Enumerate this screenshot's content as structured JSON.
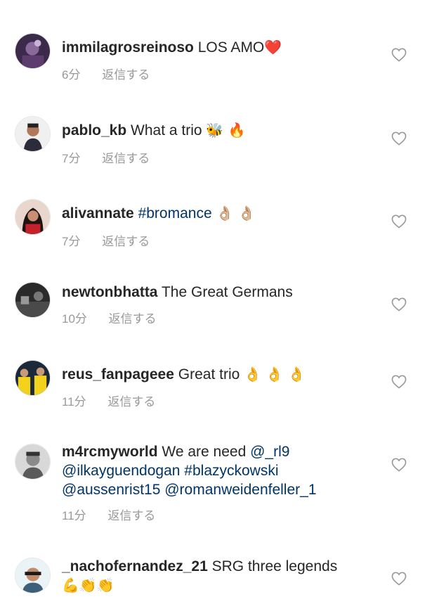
{
  "colors": {
    "username": "#262626",
    "text": "#262626",
    "link": "#003569",
    "meta": "#999999",
    "heart_outline": "#999999"
  },
  "comments": [
    {
      "username": "immilagrosreinoso",
      "text": "LOS AMO",
      "emoji": "❤️",
      "time": "6分",
      "reply": "返信する"
    },
    {
      "username": "pablo_kb",
      "text": "What a trio",
      "emoji": "🐝 🔥",
      "time": "7分",
      "reply": "返信する"
    },
    {
      "username": "alivannate",
      "hashtag": "#bromance",
      "emoji": "👌🏼 👌🏼",
      "time": "7分",
      "reply": "返信する"
    },
    {
      "username": "newtonbhatta",
      "text": "The Great Germans",
      "time": "10分",
      "reply": "返信する"
    },
    {
      "username": "reus_fanpageee",
      "text": "Great trio",
      "emoji": "👌 👌 👌",
      "time": "11分",
      "reply": "返信する"
    },
    {
      "username": "m4rcmyworld",
      "text": "We are need",
      "mention_1": "@_rl9",
      "mention_2": "@ilkayguendogan",
      "hashtag": "#blazyckowski",
      "mention_3": "@aussenrist15",
      "mention_4": "@romanweidenfeller_1",
      "time": "11分",
      "reply": "返信する"
    },
    {
      "username": "_nachofernandez_21",
      "text": "SRG three legends",
      "emoji": "💪👏👏"
    }
  ],
  "icons": {
    "like": "heart-outline-icon"
  }
}
